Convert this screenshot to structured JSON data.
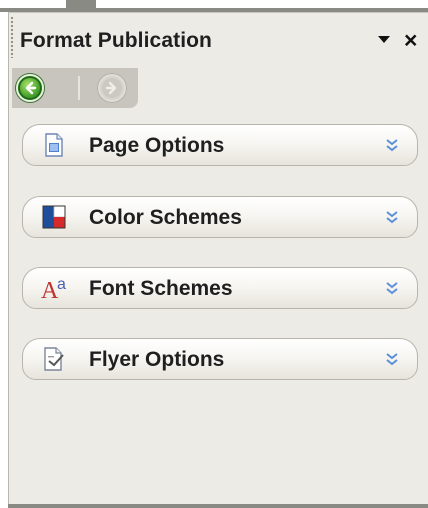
{
  "panel": {
    "title": "Format Publication",
    "menu_icon": "chevron-down-icon",
    "close_label": "×"
  },
  "nav": {
    "back_icon": "back-arrow-icon",
    "forward_icon": "forward-arrow-icon",
    "back_color": "#3f9a28",
    "forward_color": "#b8b6ae"
  },
  "sections": [
    {
      "label": "Page Options",
      "icon": "page-icon"
    },
    {
      "label": "Color Schemes",
      "icon": "color-swatch-icon"
    },
    {
      "label": "Font Schemes",
      "icon": "font-icon"
    },
    {
      "label": "Flyer Options",
      "icon": "flyer-icon"
    }
  ],
  "colors": {
    "pane_bg": "#ecebe6",
    "chevron": "#5b8fd9"
  }
}
